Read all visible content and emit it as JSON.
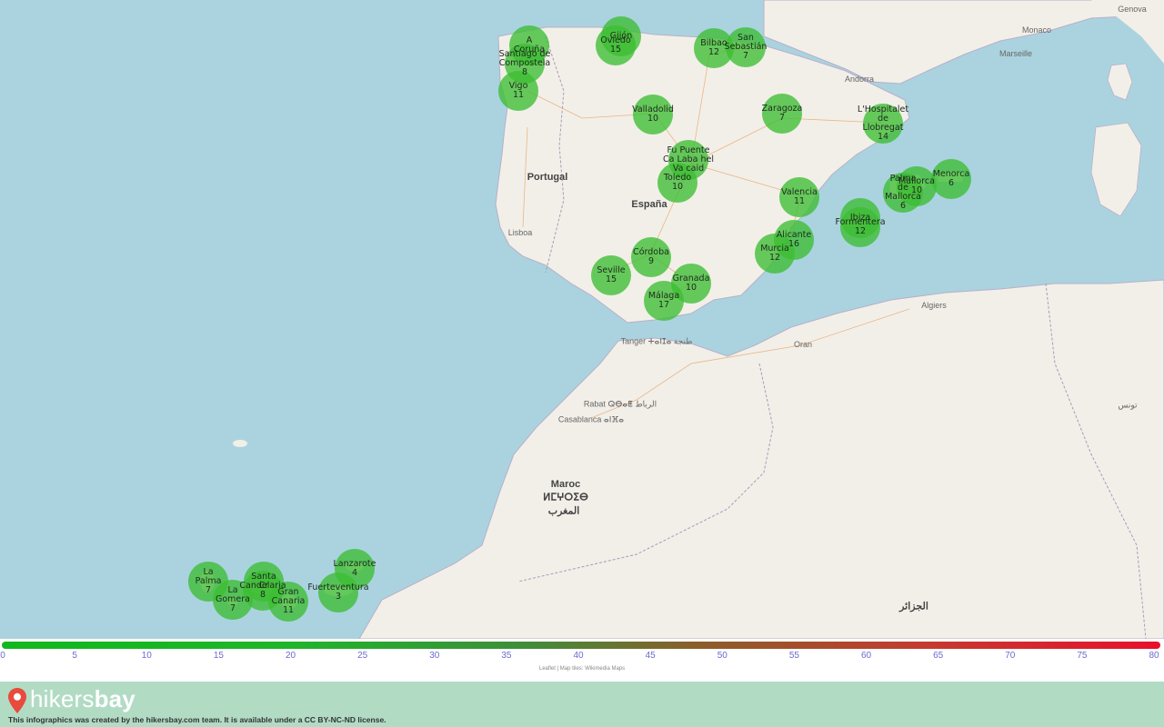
{
  "markers": [
    {
      "name": "A Coruña",
      "label_lines": [
        "A",
        "Coruña"
      ],
      "value": 6
    },
    {
      "name": "Gijón",
      "label_lines": [
        "Gijón"
      ],
      "value": null
    },
    {
      "name": "Oviedo",
      "label_lines": [
        "Oviedo",
        "15"
      ],
      "value": 15
    },
    {
      "name": "Bilbao",
      "label_lines": [
        "Bilbao",
        "12"
      ],
      "value": 12
    },
    {
      "name": "San Sebastián",
      "label_lines": [
        "San",
        "Sebastián",
        "7"
      ],
      "value": 7
    },
    {
      "name": "Santiago de Compostela",
      "label_lines": [
        "Santiago de",
        "Compostela",
        "8"
      ],
      "value": 8
    },
    {
      "name": "Vigo",
      "label_lines": [
        "Vigo",
        "11"
      ],
      "value": 11
    },
    {
      "name": "Valladolid",
      "label_lines": [
        "Valladolid",
        "10"
      ],
      "value": 10
    },
    {
      "name": "Zaragoza",
      "label_lines": [
        "Zaragoza",
        "7"
      ],
      "value": 7
    },
    {
      "name": "L'Hospitalet de Llobregat",
      "label_lines": [
        "L'Hospitalet",
        "de",
        "Llobregat",
        "14"
      ],
      "value": 14
    },
    {
      "name": "Madrid cluster",
      "label_lines": [
        "Fu Puente",
        "Ca Laba hel",
        "Va caid"
      ],
      "value": null
    },
    {
      "name": "Toledo",
      "label_lines": [
        "Toledo",
        "10"
      ],
      "value": 10
    },
    {
      "name": "Valencia",
      "label_lines": [
        "Valencia",
        "11"
      ],
      "value": 11
    },
    {
      "name": "Palma de Mallorca",
      "label_lines": [
        "Palma",
        "de",
        "Mallorca",
        "6"
      ],
      "value": 6
    },
    {
      "name": "Menorca",
      "label_lines": [
        "Menorca",
        "6"
      ],
      "value": 6
    },
    {
      "name": "Mallorca",
      "label_lines": [
        "Mallorca",
        "10"
      ],
      "value": 10
    },
    {
      "name": "Ibiza",
      "label_lines": [
        "Ibiza"
      ],
      "value": null
    },
    {
      "name": "Formentera",
      "label_lines": [
        "Formentera",
        "12"
      ],
      "value": 12
    },
    {
      "name": "Alicante",
      "label_lines": [
        "Alicante",
        "16"
      ],
      "value": 16
    },
    {
      "name": "Murcia",
      "label_lines": [
        "Murcia",
        "12"
      ],
      "value": 12
    },
    {
      "name": "Córdoba",
      "label_lines": [
        "Córdoba",
        "9"
      ],
      "value": 9
    },
    {
      "name": "Seville",
      "label_lines": [
        "Seville",
        "15"
      ],
      "value": 15
    },
    {
      "name": "Granada",
      "label_lines": [
        "Granada",
        "10"
      ],
      "value": 10
    },
    {
      "name": "Málaga",
      "label_lines": [
        "Málaga",
        "17"
      ],
      "value": 17
    },
    {
      "name": "Lanzarote",
      "label_lines": [
        "Lanzarote",
        "4"
      ],
      "value": 4
    },
    {
      "name": "La Palma",
      "label_lines": [
        "La",
        "Palma",
        "7"
      ],
      "value": 7
    },
    {
      "name": "Santa Cruz",
      "label_lines": [
        "Santa",
        "Cr"
      ],
      "value": null
    },
    {
      "name": "Candelaria",
      "label_lines": [
        "Candelaria",
        "8"
      ],
      "value": 8
    },
    {
      "name": "La Gomera",
      "label_lines": [
        "La",
        "Gomera",
        "7"
      ],
      "value": 7
    },
    {
      "name": "Gran Canaria",
      "label_lines": [
        "Gran",
        "Canaria",
        "11"
      ],
      "value": 11
    },
    {
      "name": "Fuerteventura",
      "label_lines": [
        "Fuerteventura",
        "3"
      ],
      "value": 3
    }
  ],
  "place_labels": [
    {
      "text": "Portugal",
      "kind": "country"
    },
    {
      "text": "España",
      "kind": "country"
    },
    {
      "text": "Maroc",
      "kind": "country"
    },
    {
      "text": "ⵍⵎⵖⵔⵉⴱ",
      "kind": "country"
    },
    {
      "text": "المغرب",
      "kind": "country"
    },
    {
      "text": "Lisboa",
      "kind": "city"
    },
    {
      "text": "Marseille",
      "kind": "city"
    },
    {
      "text": "Monaco",
      "kind": "city"
    },
    {
      "text": "Genova",
      "kind": "city"
    },
    {
      "text": "Andorra",
      "kind": "city"
    },
    {
      "text": "Algiers",
      "kind": "city"
    },
    {
      "text": "Oran",
      "kind": "city"
    },
    {
      "text": "Tanger ⵜⴰⵏⵊⴰ طنجة",
      "kind": "city"
    },
    {
      "text": "Rabat ⵕⴱⴰⵟ الرباط",
      "kind": "city"
    },
    {
      "text": "Casablanca ⴰⵏⴼⴰ",
      "kind": "city"
    },
    {
      "text": "تونس",
      "kind": "city"
    },
    {
      "text": "الجزائر",
      "kind": "country"
    }
  ],
  "scale": {
    "ticks": [
      "0",
      "5",
      "10",
      "15",
      "20",
      "25",
      "30",
      "35",
      "40",
      "45",
      "50",
      "55",
      "60",
      "65",
      "70",
      "75",
      "80"
    ],
    "attribution": "Leaflet | Map tiles: Wikimedia Maps"
  },
  "footer": {
    "brand_light": "hikers",
    "brand_bold": "bay",
    "credit": "This infographics was created by the hikersbay.com team. It is available under a CC BY-NC-ND license."
  },
  "colors": {
    "sea": "#aad3df",
    "land": "#f2efe9",
    "marker": "#3cbe32",
    "footer": "#b2dbc4",
    "tick_text": "#6a6ad0"
  }
}
